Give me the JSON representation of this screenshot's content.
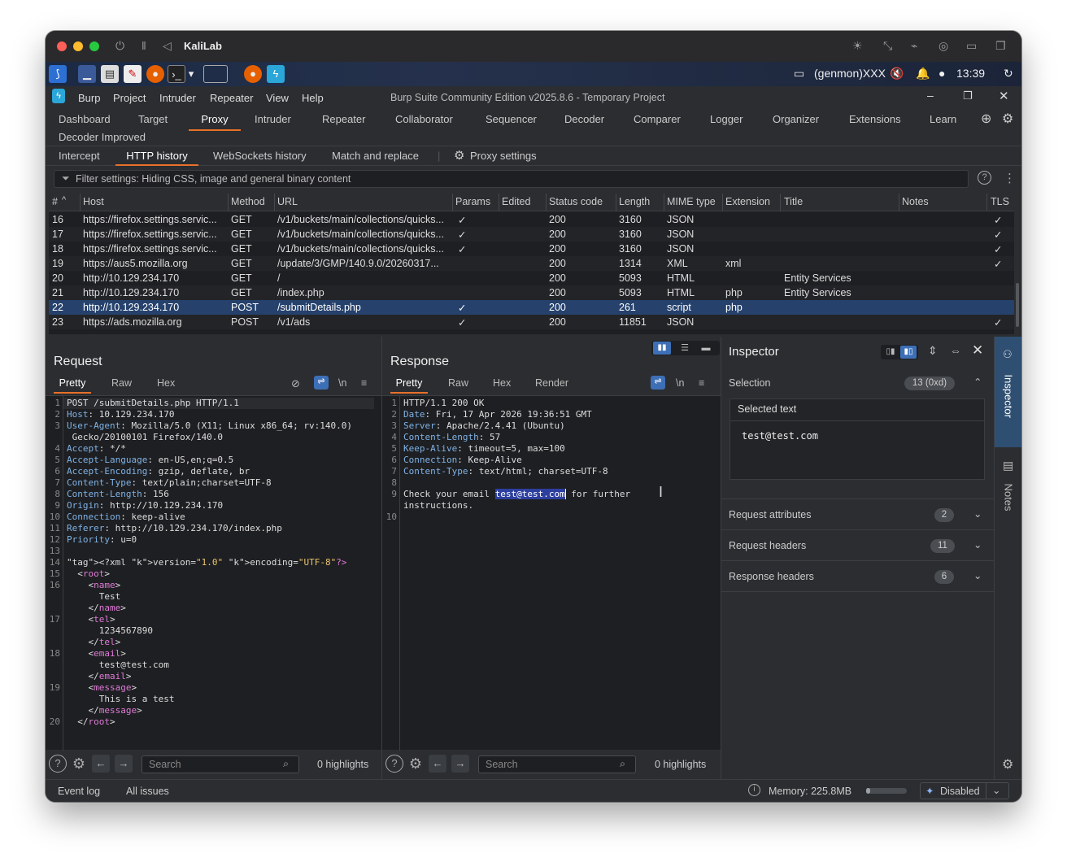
{
  "vm": {
    "title": "KaliLab"
  },
  "taskbar": {
    "tray_label": "(genmon)XXX",
    "clock": "13:39"
  },
  "menubar": {
    "items": [
      "Burp",
      "Project",
      "Intruder",
      "Repeater",
      "View",
      "Help"
    ],
    "window_title": "Burp Suite Community Edition v2025.8.6 - Temporary Project"
  },
  "nav": {
    "tabs": [
      "Dashboard",
      "Target",
      "Proxy",
      "Intruder",
      "Repeater",
      "Collaborator",
      "Sequencer",
      "Decoder",
      "Comparer",
      "Logger",
      "Organizer",
      "Extensions",
      "Learn"
    ],
    "second_row": "Decoder Improved",
    "active": "Proxy"
  },
  "proxy": {
    "subtabs": [
      "Intercept",
      "HTTP history",
      "WebSockets history",
      "Match and replace"
    ],
    "settings": "Proxy settings",
    "active": "HTTP history"
  },
  "filter": {
    "text": "Filter settings: Hiding CSS, image and general binary content"
  },
  "history": {
    "columns": [
      "#",
      "Host",
      "Method",
      "URL",
      "Params",
      "Edited",
      "Status code",
      "Length",
      "MIME type",
      "Extension",
      "Title",
      "Notes",
      "TLS"
    ],
    "rows": [
      {
        "n": "16",
        "host": "https://firefox.settings.servic...",
        "method": "GET",
        "url": "/v1/buckets/main/collections/quicks...",
        "params": "✓",
        "status": "200",
        "length": "3160",
        "mime": "JSON",
        "ext": "",
        "title": "",
        "tls": "✓"
      },
      {
        "n": "17",
        "host": "https://firefox.settings.servic...",
        "method": "GET",
        "url": "/v1/buckets/main/collections/quicks...",
        "params": "✓",
        "status": "200",
        "length": "3160",
        "mime": "JSON",
        "ext": "",
        "title": "",
        "tls": "✓"
      },
      {
        "n": "18",
        "host": "https://firefox.settings.servic...",
        "method": "GET",
        "url": "/v1/buckets/main/collections/quicks...",
        "params": "✓",
        "status": "200",
        "length": "3160",
        "mime": "JSON",
        "ext": "",
        "title": "",
        "tls": "✓"
      },
      {
        "n": "19",
        "host": "https://aus5.mozilla.org",
        "method": "GET",
        "url": "/update/3/GMP/140.9.0/20260317...",
        "params": "",
        "status": "200",
        "length": "1314",
        "mime": "XML",
        "ext": "xml",
        "title": "",
        "tls": "✓"
      },
      {
        "n": "20",
        "host": "http://10.129.234.170",
        "method": "GET",
        "url": "/",
        "params": "",
        "status": "200",
        "length": "5093",
        "mime": "HTML",
        "ext": "",
        "title": "Entity Services",
        "tls": ""
      },
      {
        "n": "21",
        "host": "http://10.129.234.170",
        "method": "GET",
        "url": "/index.php",
        "params": "",
        "status": "200",
        "length": "5093",
        "mime": "HTML",
        "ext": "php",
        "title": "Entity Services",
        "tls": ""
      },
      {
        "n": "22",
        "host": "http://10.129.234.170",
        "method": "POST",
        "url": "/submitDetails.php",
        "params": "✓",
        "status": "200",
        "length": "261",
        "mime": "script",
        "ext": "php",
        "title": "",
        "tls": ""
      },
      {
        "n": "23",
        "host": "https://ads.mozilla.org",
        "method": "POST",
        "url": "/v1/ads",
        "params": "✓",
        "status": "200",
        "length": "11851",
        "mime": "JSON",
        "ext": "",
        "title": "",
        "tls": "✓"
      }
    ],
    "selected_row": "22"
  },
  "request": {
    "title": "Request",
    "tabs": [
      "Pretty",
      "Raw",
      "Hex"
    ],
    "line_numbers": [
      "1",
      "2",
      "3",
      "",
      "4",
      "5",
      "6",
      "7",
      "8",
      "9",
      "10",
      "11",
      "12",
      "13",
      "14",
      "15",
      "16",
      "",
      "",
      "17",
      "",
      "",
      "18",
      "",
      "",
      "19",
      "",
      "",
      "20"
    ],
    "lines": [
      "POST /submitDetails.php HTTP/1.1",
      "Host: 10.129.234.170",
      "User-Agent: Mozilla/5.0 (X11; Linux x86_64; rv:140.0)",
      " Gecko/20100101 Firefox/140.0",
      "Accept: */*",
      "Accept-Language: en-US,en;q=0.5",
      "Accept-Encoding: gzip, deflate, br",
      "Content-Type: text/plain;charset=UTF-8",
      "Content-Length: 156",
      "Origin: http://10.129.234.170",
      "Connection: keep-alive",
      "Referer: http://10.129.234.170/index.php",
      "Priority: u=0",
      "",
      "<?xml version=\"1.0\" encoding=\"UTF-8\"?>",
      "  <root>",
      "    <name>",
      "      Test",
      "    </name>",
      "    <tel>",
      "      1234567890",
      "    </tel>",
      "    <email>",
      "      test@test.com",
      "    </email>",
      "    <message>",
      "      This is a test",
      "    </message>",
      "  </root>"
    ],
    "search_placeholder": "Search",
    "highlights": "0 highlights"
  },
  "response": {
    "title": "Response",
    "tabs": [
      "Pretty",
      "Raw",
      "Hex",
      "Render"
    ],
    "line_numbers": [
      "1",
      "2",
      "3",
      "4",
      "5",
      "6",
      "7",
      "8",
      "9",
      "",
      "10"
    ],
    "lines": [
      "HTTP/1.1 200 OK",
      "Date: Fri, 17 Apr 2026 19:36:51 GMT",
      "Server: Apache/2.4.41 (Ubuntu)",
      "Content-Length: 57",
      "Keep-Alive: timeout=5, max=100",
      "Connection: Keep-Alive",
      "Content-Type: text/html; charset=UTF-8",
      "",
      "Check your email ",
      "instructions.",
      ""
    ],
    "selected": "test@test.com",
    "after_selected": " for further",
    "search_placeholder": "Search",
    "highlights": "0 highlights"
  },
  "inspector": {
    "title": "Inspector",
    "selection": {
      "label": "Selection",
      "count": "13 (0xd)",
      "selected_label": "Selected text",
      "selected_value": "test@test.com"
    },
    "sections": [
      {
        "label": "Request attributes",
        "count": "2"
      },
      {
        "label": "Request headers",
        "count": "11"
      },
      {
        "label": "Response headers",
        "count": "6"
      }
    ]
  },
  "sidebar": {
    "inspector": "Inspector",
    "notes": "Notes"
  },
  "status": {
    "event_log": "Event log",
    "all_issues": "All issues",
    "memory": "Memory: 225.8MB",
    "ai": "Disabled",
    "memory_fraction": 0.1
  }
}
